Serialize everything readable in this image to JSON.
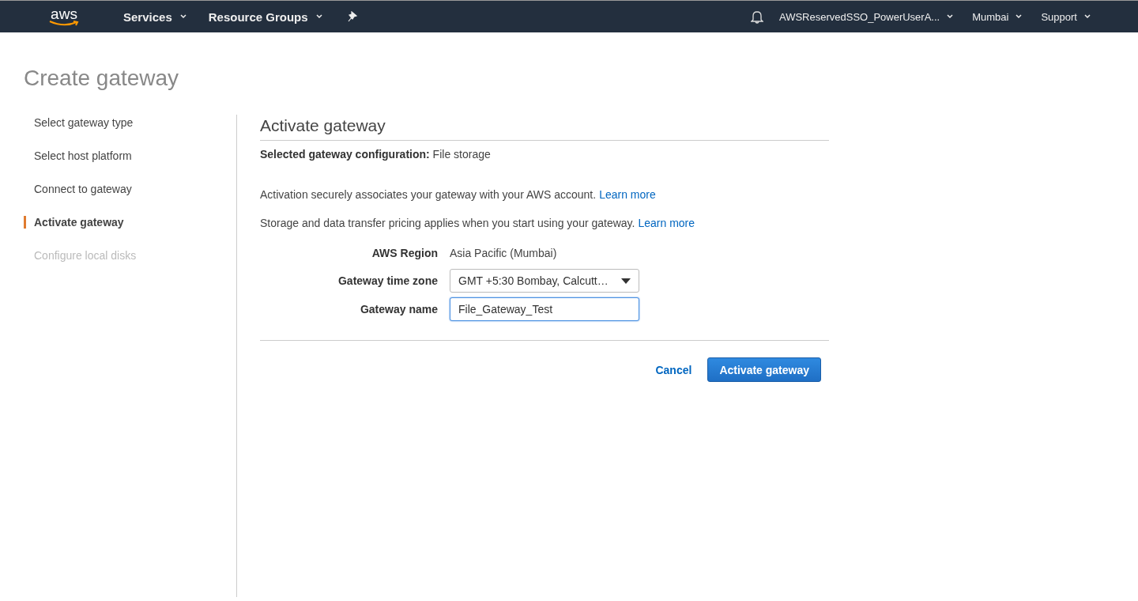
{
  "top_nav": {
    "logo": "aws",
    "menus": [
      {
        "label": "Services"
      },
      {
        "label": "Resource Groups"
      }
    ],
    "right_menus": [
      {
        "label": "AWSReservedSSO_PowerUserA..."
      },
      {
        "label": "Mumbai"
      },
      {
        "label": "Support"
      }
    ]
  },
  "page_title": "Create gateway",
  "steps": [
    {
      "label": "Select gateway type",
      "selected": false,
      "disabled": false
    },
    {
      "label": "Select host platform",
      "selected": false,
      "disabled": false
    },
    {
      "label": "Connect to gateway",
      "selected": false,
      "disabled": false
    },
    {
      "label": "Activate gateway",
      "selected": true,
      "disabled": false
    },
    {
      "label": "Configure local disks",
      "selected": false,
      "disabled": true
    }
  ],
  "section": {
    "title": "Activate gateway",
    "config_label": "Selected gateway configuration:",
    "config_value": "File storage",
    "notes": [
      {
        "text": "Activation securely associates your gateway with your AWS account.",
        "link": "Learn more"
      },
      {
        "text": "Storage and data transfer pricing applies when you start using your gateway.",
        "link": "Learn more"
      }
    ],
    "fields": [
      {
        "kind": "static",
        "label": "AWS Region",
        "value": "Asia Pacific (Mumbai)"
      },
      {
        "kind": "select",
        "label": "Gateway time zone",
        "value": "GMT +5:30 Bombay, Calcutt…"
      },
      {
        "kind": "input",
        "label": "Gateway name",
        "value": "File_Gateway_Test",
        "focused": true
      }
    ],
    "buttons": {
      "cancel": "Cancel",
      "primary": "Activate gateway"
    }
  }
}
